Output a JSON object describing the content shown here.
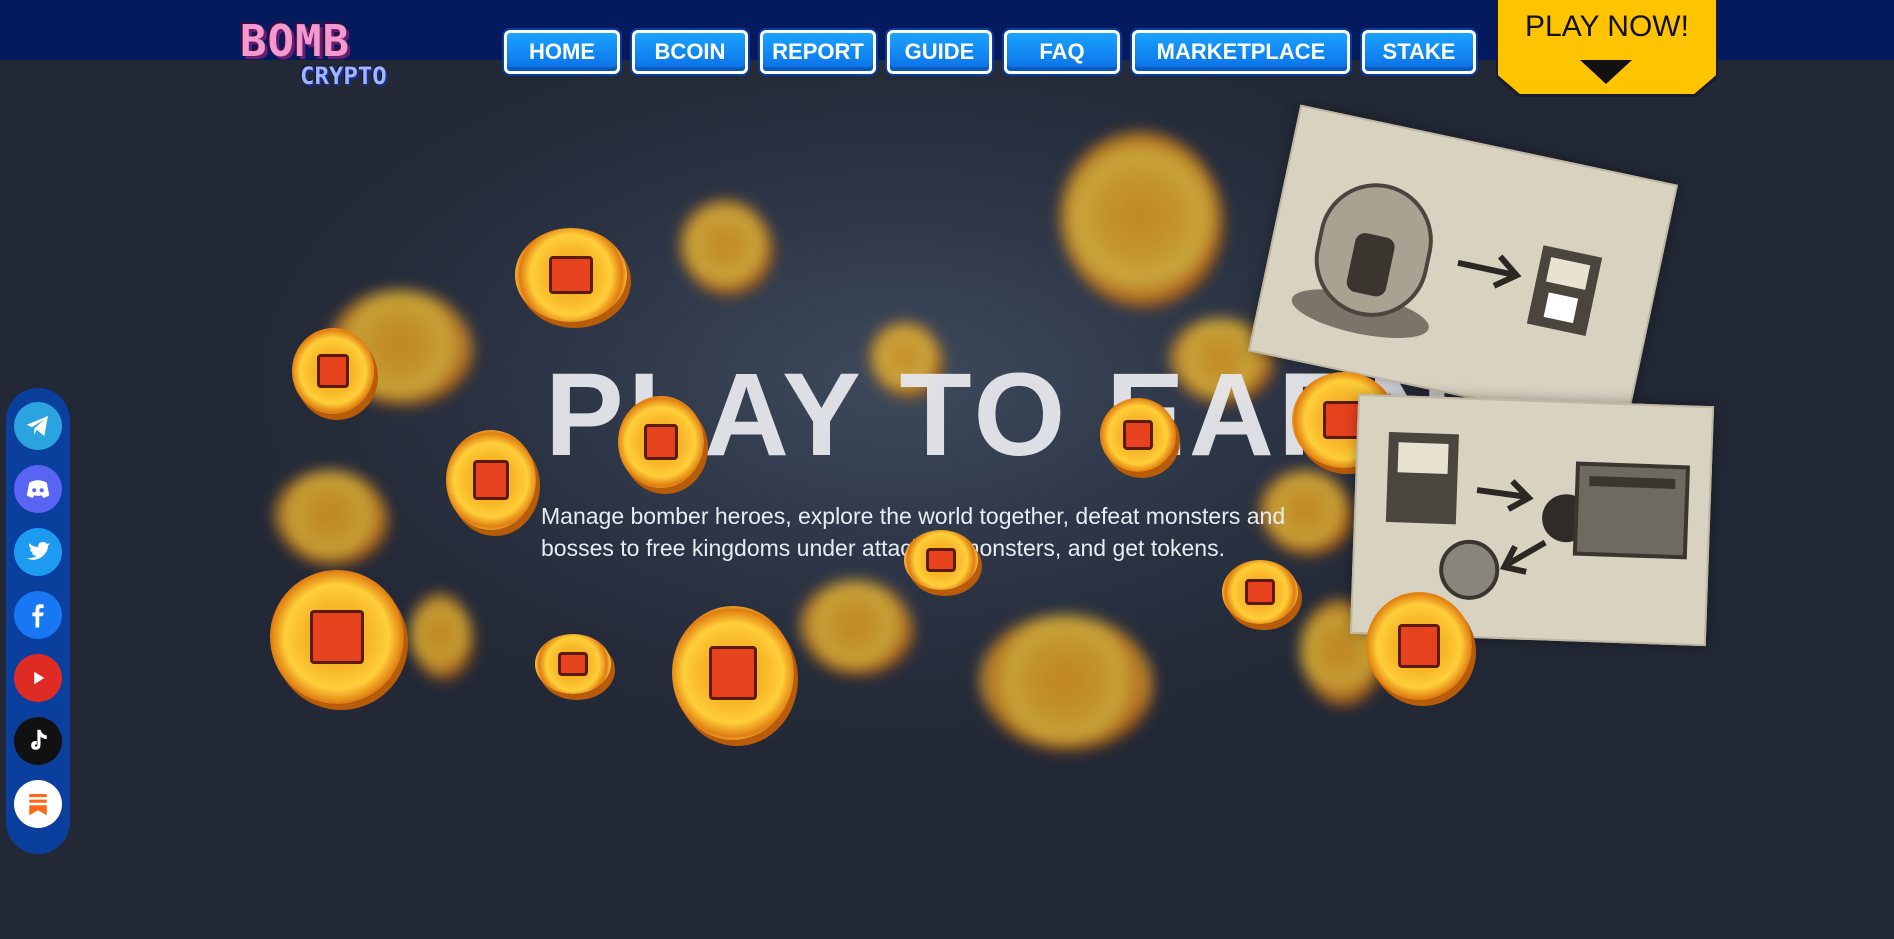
{
  "brand": {
    "logo_top": "BOMB",
    "logo_bottom": "CRYPTO"
  },
  "nav": {
    "items": [
      "HOME",
      "BCOIN",
      "REPORT",
      "GUIDE",
      "FAQ",
      "MARKETPLACE",
      "STAKE"
    ]
  },
  "cta": {
    "label": "PLAY NOW!"
  },
  "hero": {
    "title": "PLAY TO EARN",
    "description": "Manage bomber heroes, explore the world together, defeat monsters and bosses to free kingdoms under attack by monsters, and get tokens."
  },
  "social": [
    "telegram-icon",
    "discord-icon",
    "twitter-icon",
    "facebook-icon",
    "youtube-icon",
    "tiktok-icon",
    "substack-icon"
  ],
  "colors": {
    "topbar": "#031a5c",
    "nav_button": "#0a6fe6",
    "cta": "#ffc400",
    "social_bar": "#0b3f9e"
  }
}
